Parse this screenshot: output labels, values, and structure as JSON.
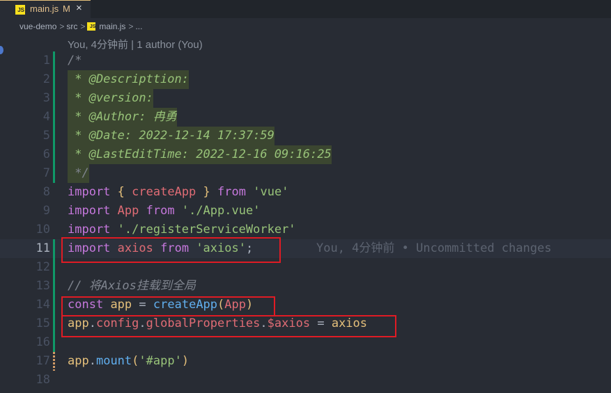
{
  "tab": {
    "icon": "JS",
    "filename": "main.js",
    "status": "M",
    "close": "×"
  },
  "breadcrumb": [
    "vue-demo",
    "src",
    "main.js",
    "..."
  ],
  "breadcrumb_sep": ">",
  "codelens": "You, 4分钟前 | 1 author (You)",
  "inline_blame": "You, 4分钟前 • Uncommitted changes",
  "line_numbers": [
    "1",
    "2",
    "3",
    "4",
    "5",
    "6",
    "7",
    "8",
    "9",
    "10",
    "11",
    "12",
    "13",
    "14",
    "15",
    "16",
    "17",
    "18"
  ],
  "lines": {
    "l1": "/*",
    "l2": " * @Descripttion:",
    "l3": " * @version:",
    "l4": " * @Author: 冉勇",
    "l5": " * @Date: 2022-12-14 17:37:59",
    "l6": " * @LastEditTime: 2022-12-16 09:16:25",
    "l7": " */",
    "l8": {
      "kw1": "import",
      "b1": "{",
      "name": "createApp",
      "b2": "}",
      "kw2": "from",
      "str": "'vue'"
    },
    "l9": {
      "kw1": "import",
      "name": "App",
      "kw2": "from",
      "str": "'./App.vue'"
    },
    "l10": {
      "kw1": "import",
      "str": "'./registerServiceWorker'"
    },
    "l11": {
      "kw1": "import",
      "name": "axios",
      "kw2": "from",
      "str": "'axios'",
      "semi": ";"
    },
    "l13": "// 将Axios挂载到全局",
    "l14": {
      "kw": "const",
      "name": "app",
      "op": "=",
      "fn": "createApp",
      "p1": "(",
      "arg": "App",
      "p2": ")"
    },
    "l15": {
      "obj": "app",
      "d1": ".",
      "p1": "config",
      "d2": ".",
      "p2": "globalProperties",
      "d3": ".",
      "p3": "$axios",
      "op": "=",
      "val": "axios"
    },
    "l17": {
      "obj": "app",
      "d": ".",
      "fn": "mount",
      "p1": "(",
      "str": "'#app'",
      "p2": ")"
    }
  }
}
